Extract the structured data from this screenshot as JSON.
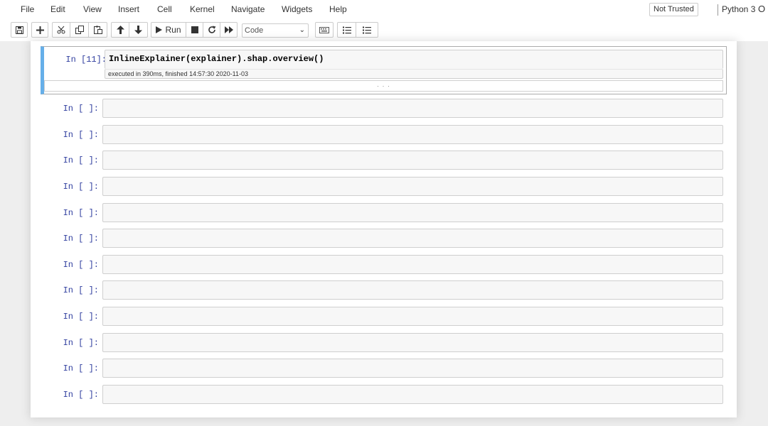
{
  "menubar": {
    "items": [
      "File",
      "Edit",
      "View",
      "Insert",
      "Cell",
      "Kernel",
      "Navigate",
      "Widgets",
      "Help"
    ],
    "trust_label": "Not Trusted",
    "kernel_name": "Python 3",
    "kernel_indicator": "O"
  },
  "toolbar": {
    "run_label": "Run",
    "cell_type": "Code",
    "icons": [
      "save-icon",
      "plus-icon",
      "scissors-icon",
      "copy-icon",
      "paste-icon",
      "arrow-up-icon",
      "arrow-down-icon",
      "play-icon",
      "stop-icon",
      "restart-icon",
      "fast-forward-icon",
      "keyboard-icon",
      "list-numbered-icon",
      "list-icon"
    ]
  },
  "cells": [
    {
      "prompt": "In [11]:",
      "source": "InlineExplainer(explainer).shap.overview()",
      "exec_info": "executed in 390ms, finished 14:57:30 2020-11-03",
      "output_collapsed": "· · ·"
    },
    {
      "prompt": "In [ ]:"
    },
    {
      "prompt": "In [ ]:"
    },
    {
      "prompt": "In [ ]:"
    },
    {
      "prompt": "In [ ]:"
    },
    {
      "prompt": "In [ ]:"
    },
    {
      "prompt": "In [ ]:"
    },
    {
      "prompt": "In [ ]:"
    },
    {
      "prompt": "In [ ]:"
    },
    {
      "prompt": "In [ ]:"
    },
    {
      "prompt": "In [ ]:"
    },
    {
      "prompt": "In [ ]:"
    },
    {
      "prompt": "In [ ]:"
    }
  ]
}
